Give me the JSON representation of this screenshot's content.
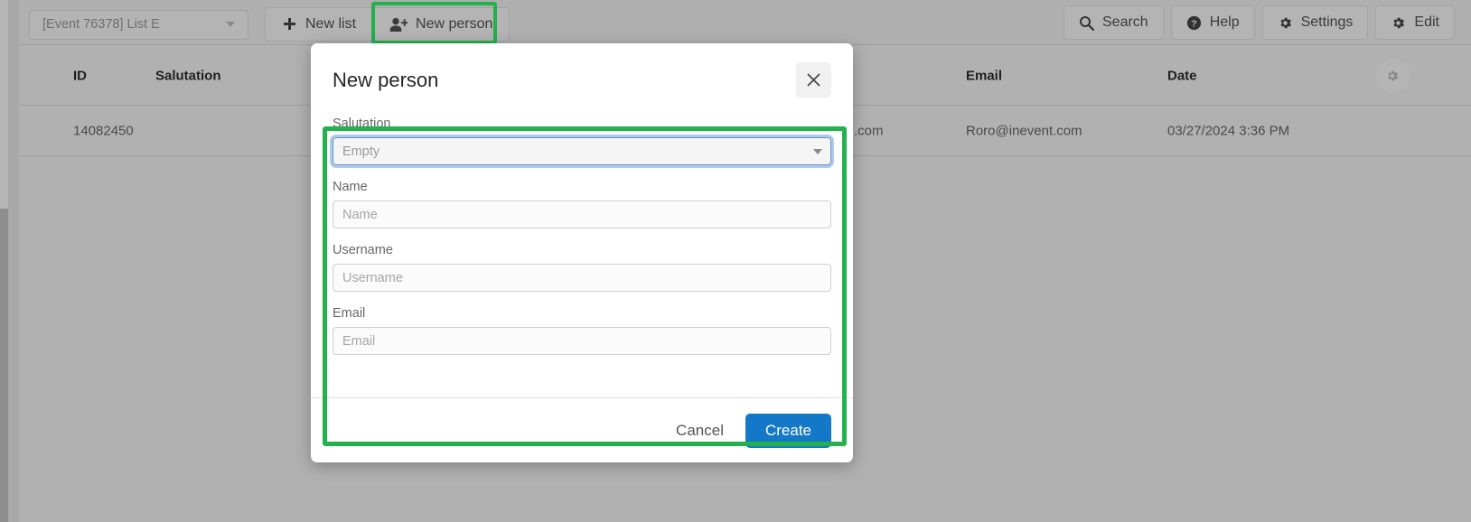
{
  "toolbar": {
    "list_select": {
      "value": "[Event 76378] List E",
      "caret_icon": "chevron-down-icon"
    },
    "new_list": {
      "label": "New list",
      "icon": "plus-icon"
    },
    "new_person": {
      "label": "New person",
      "icon": "user-plus-icon"
    },
    "search": {
      "label": "Search",
      "icon": "search-icon"
    },
    "help": {
      "label": "Help",
      "icon": "question-circle-icon"
    },
    "settings": {
      "label": "Settings",
      "icon": "gear-icon"
    },
    "edit": {
      "label": "Edit",
      "icon": "gear-icon"
    }
  },
  "table": {
    "columns": [
      "ID",
      "Salutation",
      "Email",
      "Date"
    ],
    "settings_icon": "gear-icon",
    "rows": [
      {
        "id": "14082450",
        "salutation": "",
        "partial_text": ".com",
        "email": "Roro@inevent.com",
        "date": "03/27/2024 3:36 PM"
      }
    ]
  },
  "modal": {
    "title": "New person",
    "close_icon": "close-icon",
    "fields": [
      {
        "label": "Salutation",
        "type": "select",
        "value": "Empty",
        "options": [
          "Empty"
        ],
        "caret_icon": "chevron-down-icon",
        "focused": true
      },
      {
        "label": "Name",
        "type": "text",
        "value": "",
        "placeholder": "Name"
      },
      {
        "label": "Username",
        "type": "text",
        "value": "",
        "placeholder": "Username"
      },
      {
        "label": "Email",
        "type": "text",
        "value": "",
        "placeholder": "Email"
      }
    ],
    "cancel_label": "Cancel",
    "create_label": "Create"
  },
  "highlights": {
    "color": "#22b14c",
    "targets": [
      "new-person-button",
      "new-person-form"
    ]
  }
}
